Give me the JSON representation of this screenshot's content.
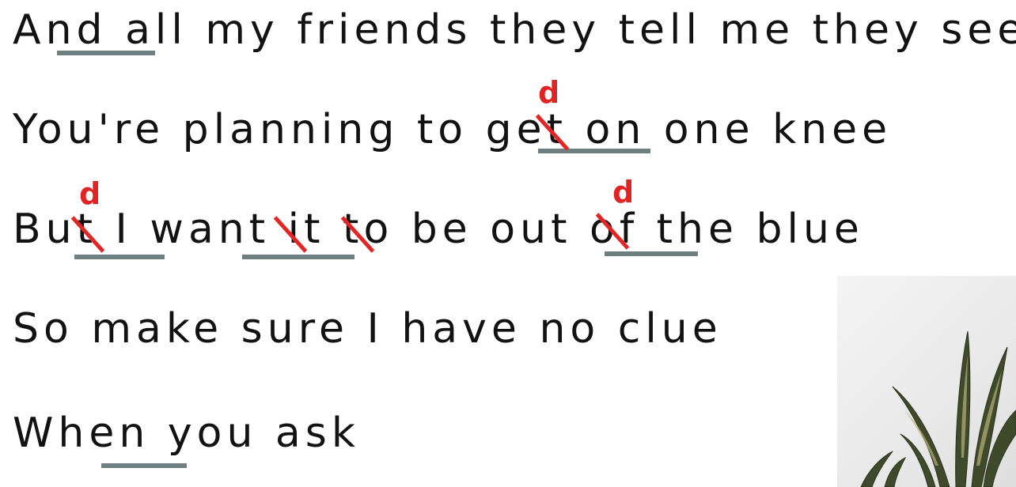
{
  "lyrics": {
    "lines": [
      "And all my friends they tell me they see",
      "You're planning to get on one knee",
      "But I want it to be out of the blue",
      "So make sure I have no clue",
      "When you ask"
    ]
  },
  "annotations": {
    "sound_change_letter": "d",
    "colors": {
      "text": "#121212",
      "linking_underline": "#6f7f80",
      "sound_change": "#e02424",
      "plant_leaf_dark": "#3f4a2a",
      "plant_leaf_light": "#b9b07a"
    }
  }
}
